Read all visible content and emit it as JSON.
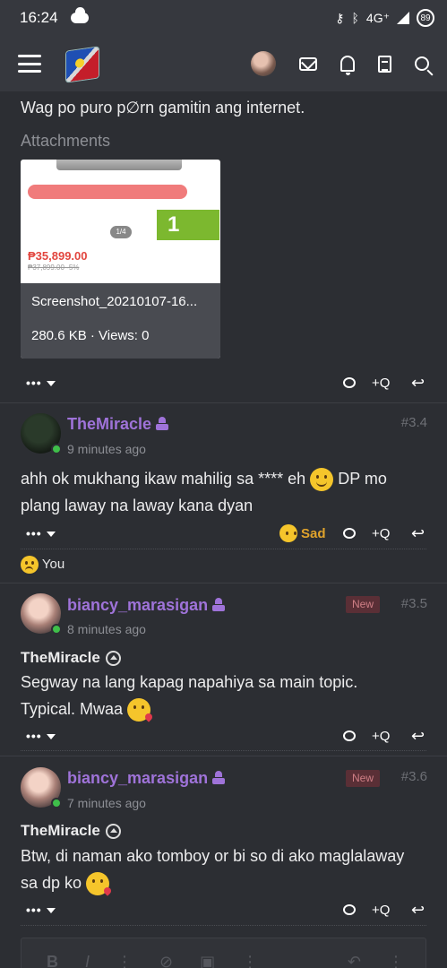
{
  "status": {
    "time": "16:24",
    "network": "4G⁺",
    "battery": "89"
  },
  "header": {
    "menu_icon": "hamburger-menu-icon",
    "logo_icon": "site-logo-cube",
    "icons": [
      "avatar",
      "mail-icon",
      "bell-icon",
      "document-icon",
      "search-icon"
    ]
  },
  "post0": {
    "text": "Wag po puro p∅rn gamitin ang internet.",
    "attachments_label": "Attachments",
    "attachment": {
      "filename": "Screenshot_20210107-16...",
      "meta": "280.6 KB · Views: 0",
      "thumb_price": "₱35,899.00",
      "thumb_badge": "1",
      "thumb_pager": "1/4"
    }
  },
  "actions": {
    "more": "•••",
    "quote": "+Q"
  },
  "post1": {
    "username": "TheMiracle",
    "time": "9 minutes ago",
    "number": "#3.4",
    "line1_a": "ahh ok mukhang ikaw mahilig sa **** eh",
    "line1_b": "DP mo",
    "line2": "plang laway na laway kana dyan",
    "reaction": "Sad",
    "reacted_by": "You"
  },
  "post2": {
    "username": "biancy_marasigan",
    "time": "8 minutes ago",
    "number": "#3.5",
    "badge": "New",
    "quote_author": "TheMiracle",
    "line1": "Segway na lang kapag napahiya sa main topic.",
    "line2": "Typical. Mwaa"
  },
  "post3": {
    "username": "biancy_marasigan",
    "time": "7 minutes ago",
    "number": "#3.6",
    "badge": "New",
    "quote_author": "TheMiracle",
    "line1": "Btw, di naman ako tomboy or bi so di ako maglalaway",
    "line2": "sa dp ko"
  },
  "editor": {
    "bold": "B",
    "italic": "I",
    "more1": "⋮",
    "link": "⊘",
    "image": "▣",
    "more2": "⋮",
    "undo": "↶",
    "more3": "⋮"
  }
}
